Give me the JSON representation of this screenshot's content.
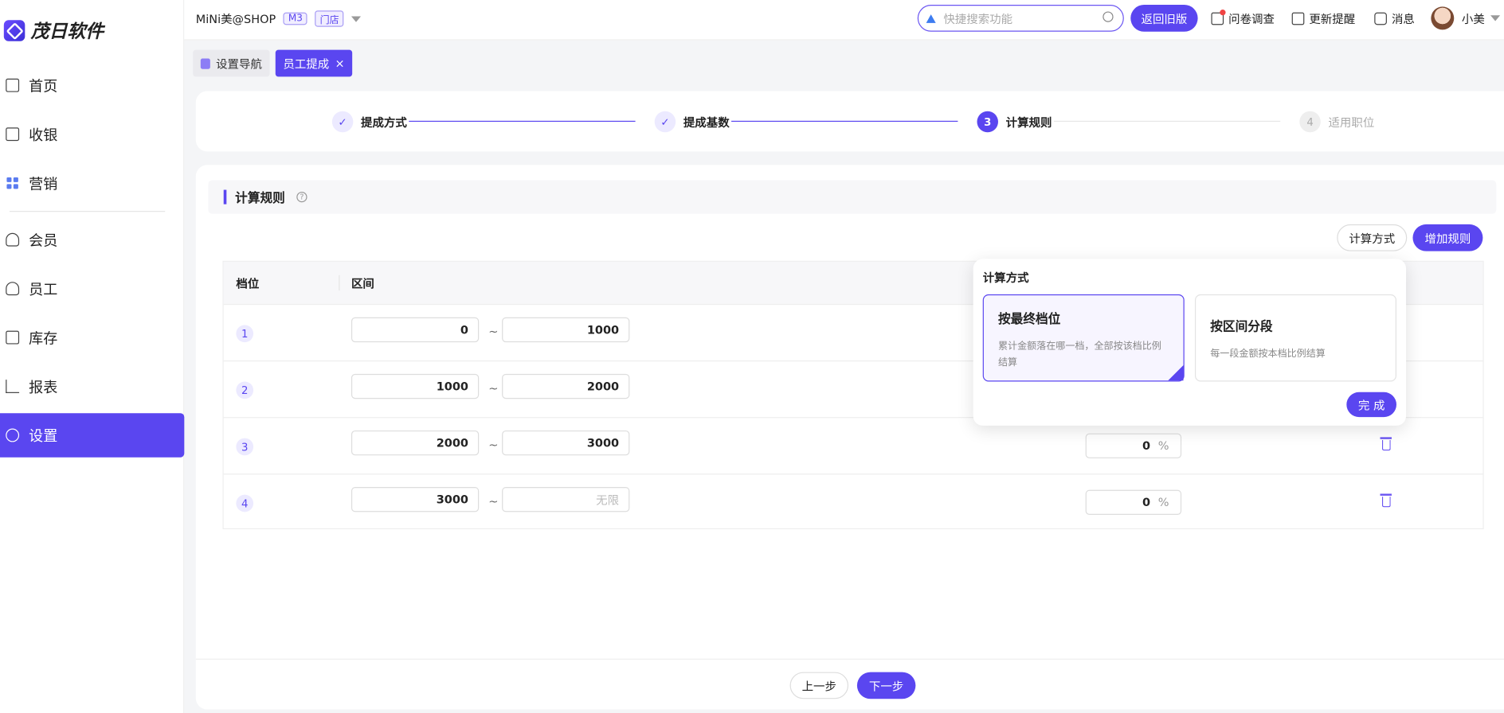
{
  "app": {
    "logo_text": "茂日软件"
  },
  "header": {
    "shop_name": "MiNi美@SHOP",
    "tag_m3": "M3",
    "tag_store": "门店",
    "search_placeholder": "快捷搜索功能",
    "old_version_label": "返回旧版",
    "survey_label": "问卷调查",
    "update_label": "更新提醒",
    "message_label": "消息",
    "user_name": "小美"
  },
  "sidebar": {
    "items": [
      {
        "label": "首页",
        "icon": "home-icon"
      },
      {
        "label": "收银",
        "icon": "cashier-icon"
      },
      {
        "label": "营销",
        "icon": "marketing-icon"
      },
      {
        "label": "会员",
        "icon": "member-icon"
      },
      {
        "label": "员工",
        "icon": "staff-icon"
      },
      {
        "label": "库存",
        "icon": "inventory-icon"
      },
      {
        "label": "报表",
        "icon": "report-icon"
      },
      {
        "label": "设置",
        "icon": "settings-icon",
        "active": true
      }
    ]
  },
  "tabs": [
    {
      "label": "设置导航"
    },
    {
      "label": "员工提成",
      "active": true,
      "close": "×"
    }
  ],
  "steps": [
    {
      "num": "✓",
      "label": "提成方式",
      "state": "done"
    },
    {
      "num": "✓",
      "label": "提成基数",
      "state": "done"
    },
    {
      "num": "3",
      "label": "计算规则",
      "state": "current"
    },
    {
      "num": "4",
      "label": "适用职位",
      "state": "todo"
    }
  ],
  "section": {
    "title": "计算规则",
    "help": "?"
  },
  "buttons": {
    "calc_method": "计算方式",
    "add_rule": "增加规则",
    "prev": "上一步",
    "next": "下一步"
  },
  "table": {
    "headers": {
      "level": "档位",
      "range": "区间"
    },
    "tilde": "~",
    "rows": [
      {
        "level": "1",
        "from": "0",
        "to": "1000"
      },
      {
        "level": "2",
        "from": "1000",
        "to": "2000"
      },
      {
        "level": "3",
        "from": "2000",
        "to": "3000",
        "percent": "0",
        "unit": "%"
      },
      {
        "level": "4",
        "from": "3000",
        "to_placeholder": "无限",
        "percent": "0",
        "unit": "%"
      }
    ]
  },
  "popover": {
    "title": "计算方式",
    "option_final": {
      "title": "按最终档位",
      "desc": "累计金额落在哪一档，全部按该档比例结算",
      "selected": true
    },
    "option_segment": {
      "title": "按区间分段",
      "desc": "每一段金额按本档比例结算"
    },
    "done_label": "完 成"
  },
  "colors": {
    "accent": "#5a46f0"
  }
}
